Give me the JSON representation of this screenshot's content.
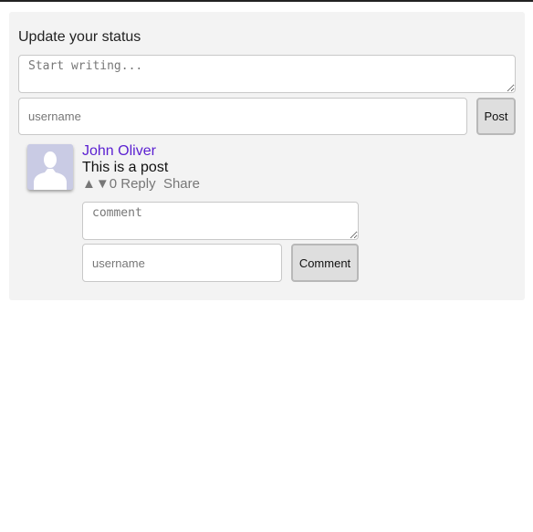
{
  "status_form": {
    "heading": "Update your status",
    "text_placeholder": "Start writing...",
    "username_placeholder": "username",
    "post_label": "Post"
  },
  "post": {
    "author": "John Oliver",
    "text": "This is a post",
    "upvote_icon": "▲",
    "downvote_icon": "▼",
    "score": "0",
    "reply_label": "Reply",
    "share_label": "Share",
    "comment_form": {
      "text_placeholder": "comment",
      "username_placeholder": "username",
      "submit_label": "Comment"
    }
  }
}
